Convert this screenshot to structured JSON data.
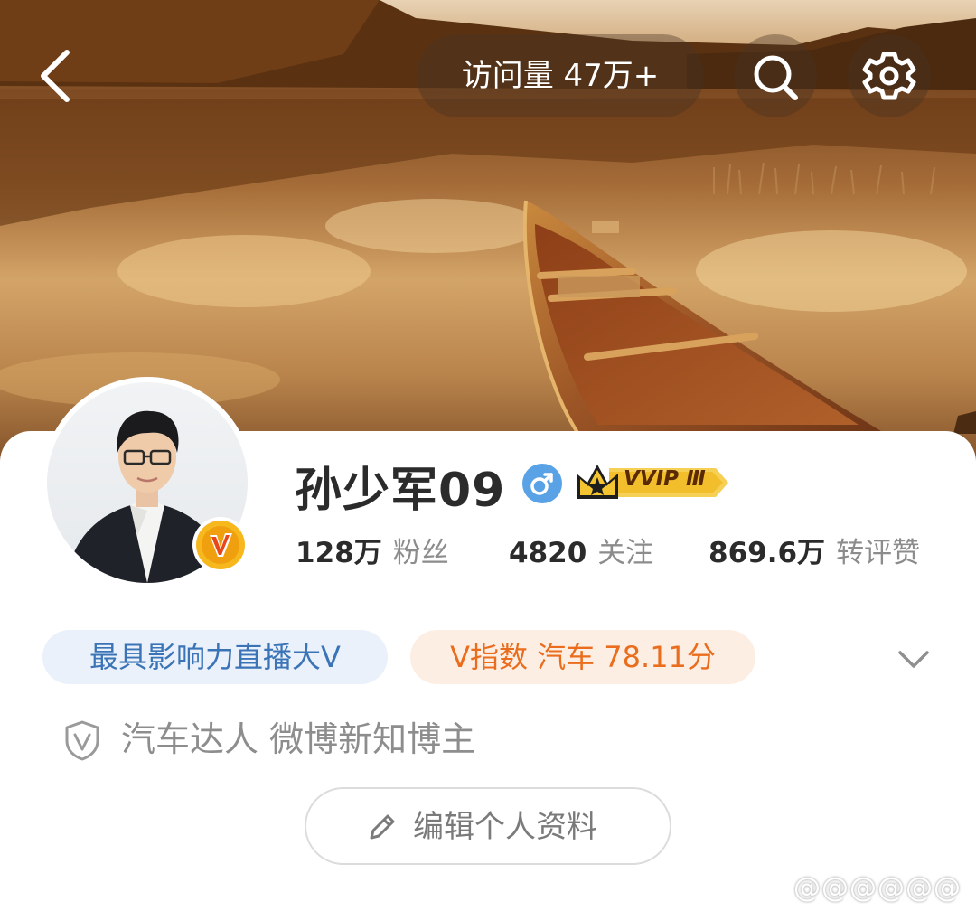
{
  "header": {
    "visits_label": "访问量 47万+"
  },
  "profile": {
    "username": "孙少军09",
    "vip_label": "VVIP Ⅲ",
    "stats": [
      {
        "value": "128万",
        "label": "粉丝"
      },
      {
        "value": "4820",
        "label": "关注"
      },
      {
        "value": "869.6万",
        "label": "转评赞"
      }
    ],
    "tags": [
      {
        "text": "最具影响力直播大V"
      },
      {
        "text": "V指数 汽车 78.11分"
      }
    ],
    "verification": "汽车达人 微博新知博主",
    "edit_button": "编辑个人资料",
    "watermark": "@@@@@@"
  },
  "icons": {
    "back": "back-chevron-icon",
    "search": "search-icon",
    "settings": "gear-icon",
    "gender": "male-icon",
    "verified": "v-badge-icon",
    "shield": "shield-v-icon",
    "expand": "chevron-down-icon",
    "edit": "pencil-icon"
  },
  "colors": {
    "tag_blue_text": "#3b74b6",
    "tag_orange_text": "#ea6d1e",
    "gender_blue": "#5aa2e6",
    "vip_gold": "#f2b51d"
  }
}
